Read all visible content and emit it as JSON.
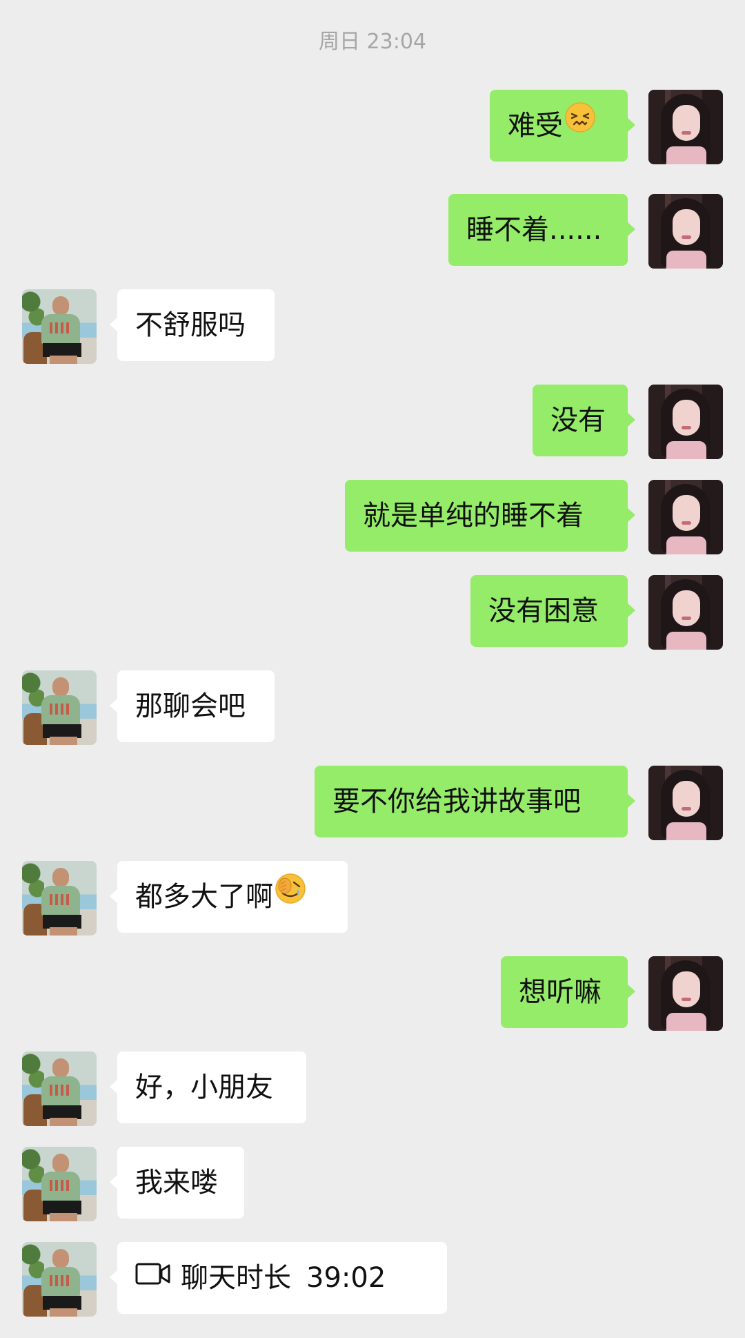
{
  "chat": {
    "timestamp": "周日 23:04",
    "messages": [
      {
        "side": "right",
        "text": "难受",
        "emoji": "confounded-face"
      },
      {
        "side": "right",
        "text": "睡不着......"
      },
      {
        "side": "left",
        "text": "不舒服吗"
      },
      {
        "side": "right",
        "text": "没有"
      },
      {
        "side": "right",
        "text": "就是单纯的睡不着"
      },
      {
        "side": "right",
        "text": "没有困意"
      },
      {
        "side": "left",
        "text": "那聊会吧"
      },
      {
        "side": "right",
        "text": "要不你给我讲故事吧"
      },
      {
        "side": "left",
        "text": "都多大了啊",
        "emoji": "facepalm-face"
      },
      {
        "side": "right",
        "text": "想听嘛"
      },
      {
        "side": "left",
        "text": "好，小朋友"
      },
      {
        "side": "left",
        "text": "我来喽"
      },
      {
        "side": "left",
        "type": "video-call",
        "text": "聊天时长",
        "duration": "39:02",
        "icon": "video-camera-icon"
      }
    ]
  },
  "colors": {
    "background": "#ededed",
    "self_bubble": "#95ec69",
    "other_bubble": "#ffffff",
    "timestamp_text": "#a6a6a6"
  }
}
